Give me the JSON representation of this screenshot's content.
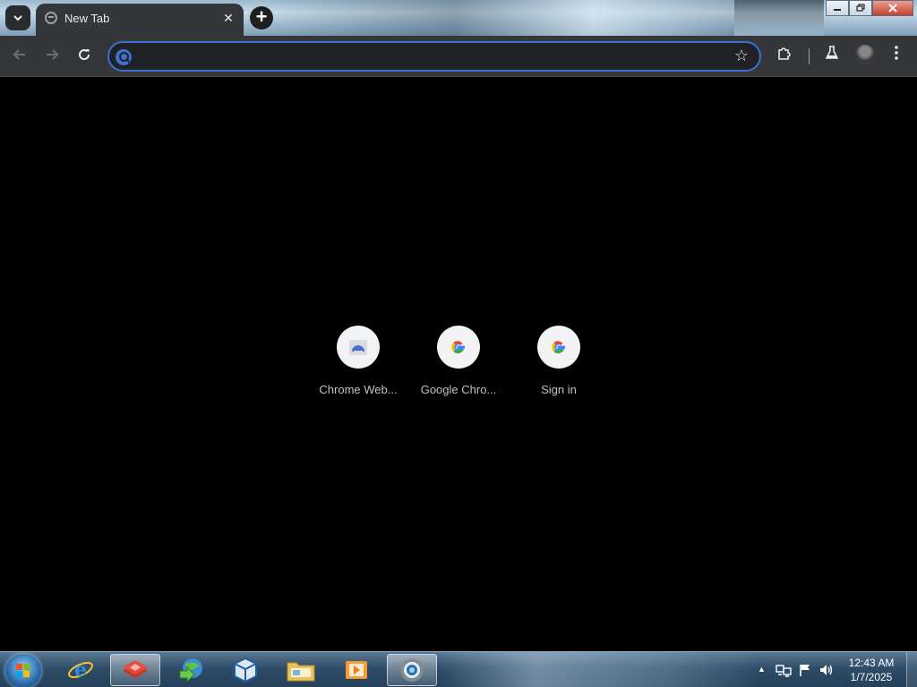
{
  "browser": {
    "tab": {
      "title": "New Tab",
      "close_icon": "close-icon"
    },
    "omnibox": {
      "value": "",
      "placeholder": ""
    }
  },
  "shortcuts": [
    {
      "label": "Chrome Web..."
    },
    {
      "label": "Google Chro..."
    },
    {
      "label": "Sign in"
    }
  ],
  "taskbar": {
    "clock_time": "12:43 AM",
    "clock_date": "1/7/2025"
  },
  "colors": {
    "accent": "#3d6fd1",
    "toolbar": "#35363a",
    "content_bg": "#000000"
  }
}
